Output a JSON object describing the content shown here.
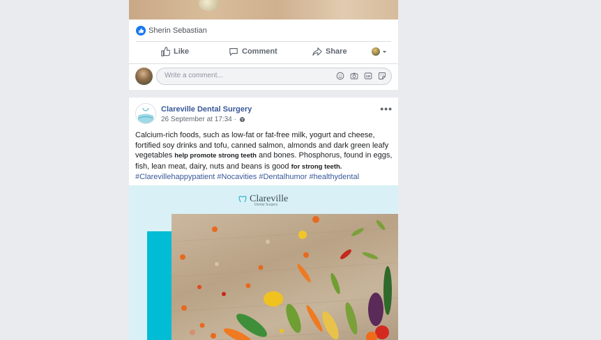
{
  "post1": {
    "liked_by": "Sherin Sebastian",
    "actions": {
      "like": "Like",
      "comment": "Comment",
      "share": "Share"
    },
    "comment_placeholder": "Write a comment..."
  },
  "post2": {
    "page_name": "Clareville Dental Surgery",
    "timestamp": "26 September at 17:34 ·",
    "text_part1": "Calcium-rich foods, such as low-fat or fat-free milk, yogurt and cheese, fortified soy drinks and tofu, canned salmon, almonds and dark green leafy vegetables ",
    "text_bold1": "help promote strong teeth",
    "text_part2": " and bones. Phosphorus, found in eggs, fish, lean meat, dairy, nuts and beans is good ",
    "text_bold2": "for strong teeth.",
    "hashtags": "#Clarevillehappypatient #Nocavities #Dentalhumor #healthydental",
    "brand": {
      "name": "Clareville",
      "subtitle": "Dental Surgery"
    }
  },
  "colors": {
    "link": "#385898",
    "facebook_blue": "#1877f2",
    "teal": "#00bcd4",
    "background": "#e9ebee"
  }
}
